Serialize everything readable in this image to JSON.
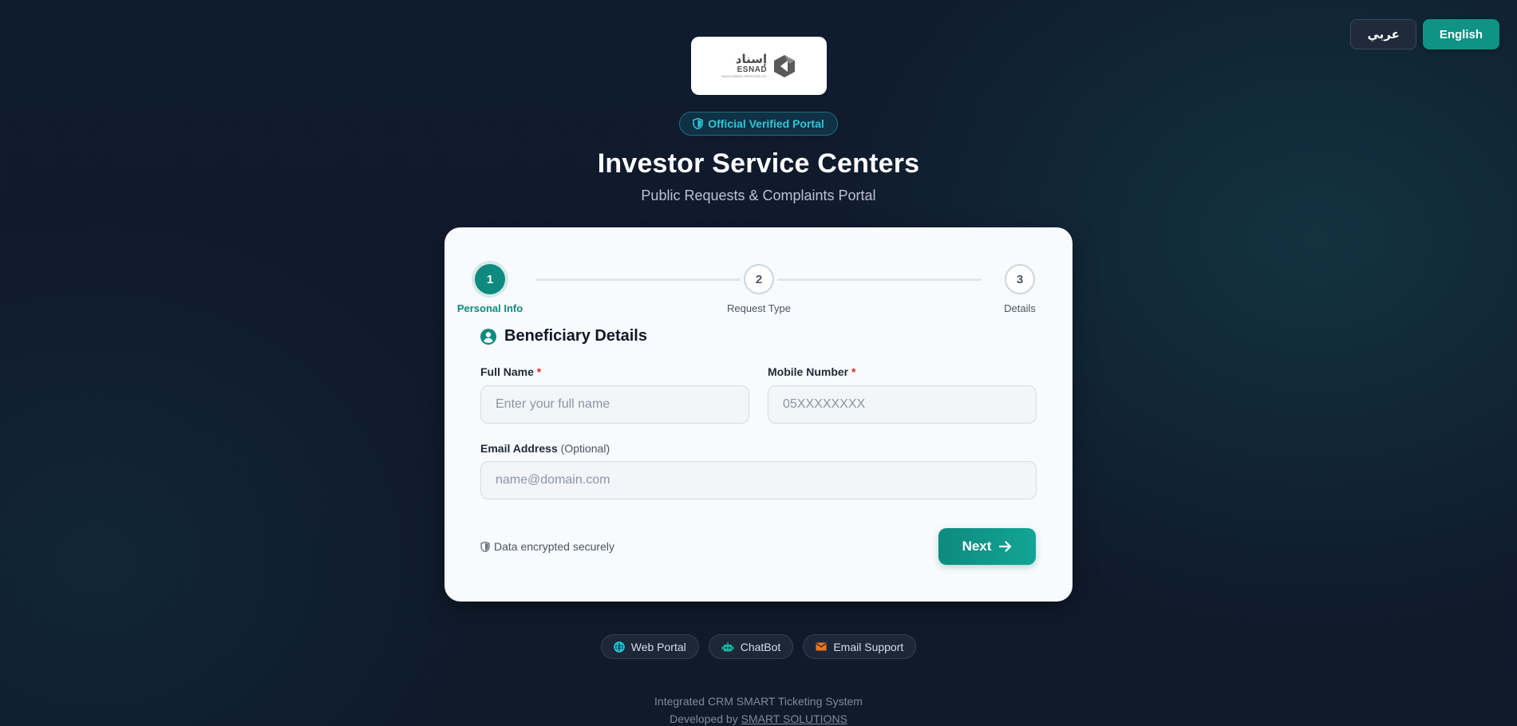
{
  "lang": {
    "arabic_label": "عربي",
    "english_label": "English"
  },
  "header": {
    "logo": {
      "arabic": "إسناد",
      "english": "ESNAD",
      "tagline": "SAUDI MINING SERVICES CO."
    },
    "badge": "Official Verified Portal",
    "title": "Investor Service Centers",
    "subtitle": "Public Requests & Complaints Portal"
  },
  "stepper": {
    "steps": [
      {
        "number": "1",
        "label": "Personal Info",
        "state": "active"
      },
      {
        "number": "2",
        "label": "Request Type",
        "state": "inactive"
      },
      {
        "number": "3",
        "label": "Details",
        "state": "inactive"
      }
    ]
  },
  "form": {
    "section_title": "Beneficiary Details",
    "full_name": {
      "label": "Full Name",
      "required_mark": "*",
      "placeholder": "Enter your full name",
      "value": ""
    },
    "mobile": {
      "label": "Mobile Number",
      "required_mark": "*",
      "placeholder": "05XXXXXXXX",
      "value": ""
    },
    "email": {
      "label": "Email Address",
      "optional_text": "(Optional)",
      "placeholder": "name@domain.com",
      "value": ""
    },
    "secure_note": "Data encrypted securely",
    "next_label": "Next"
  },
  "channels": [
    {
      "label": "Web Portal",
      "icon": "globe-icon",
      "color": "#22d3ee"
    },
    {
      "label": "ChatBot",
      "icon": "robot-icon",
      "color": "#14b8a6"
    },
    {
      "label": "Email Support",
      "icon": "envelope-icon",
      "color": "#f97316"
    }
  ],
  "footer": {
    "system_name": "Integrated CRM SMART Ticketing System",
    "developed_by": "Developed by",
    "developer": "SMART SOLUTIONS"
  },
  "colors": {
    "accent": "#0e8a7e",
    "background": "#0f1b2e",
    "required": "#dc2626"
  }
}
